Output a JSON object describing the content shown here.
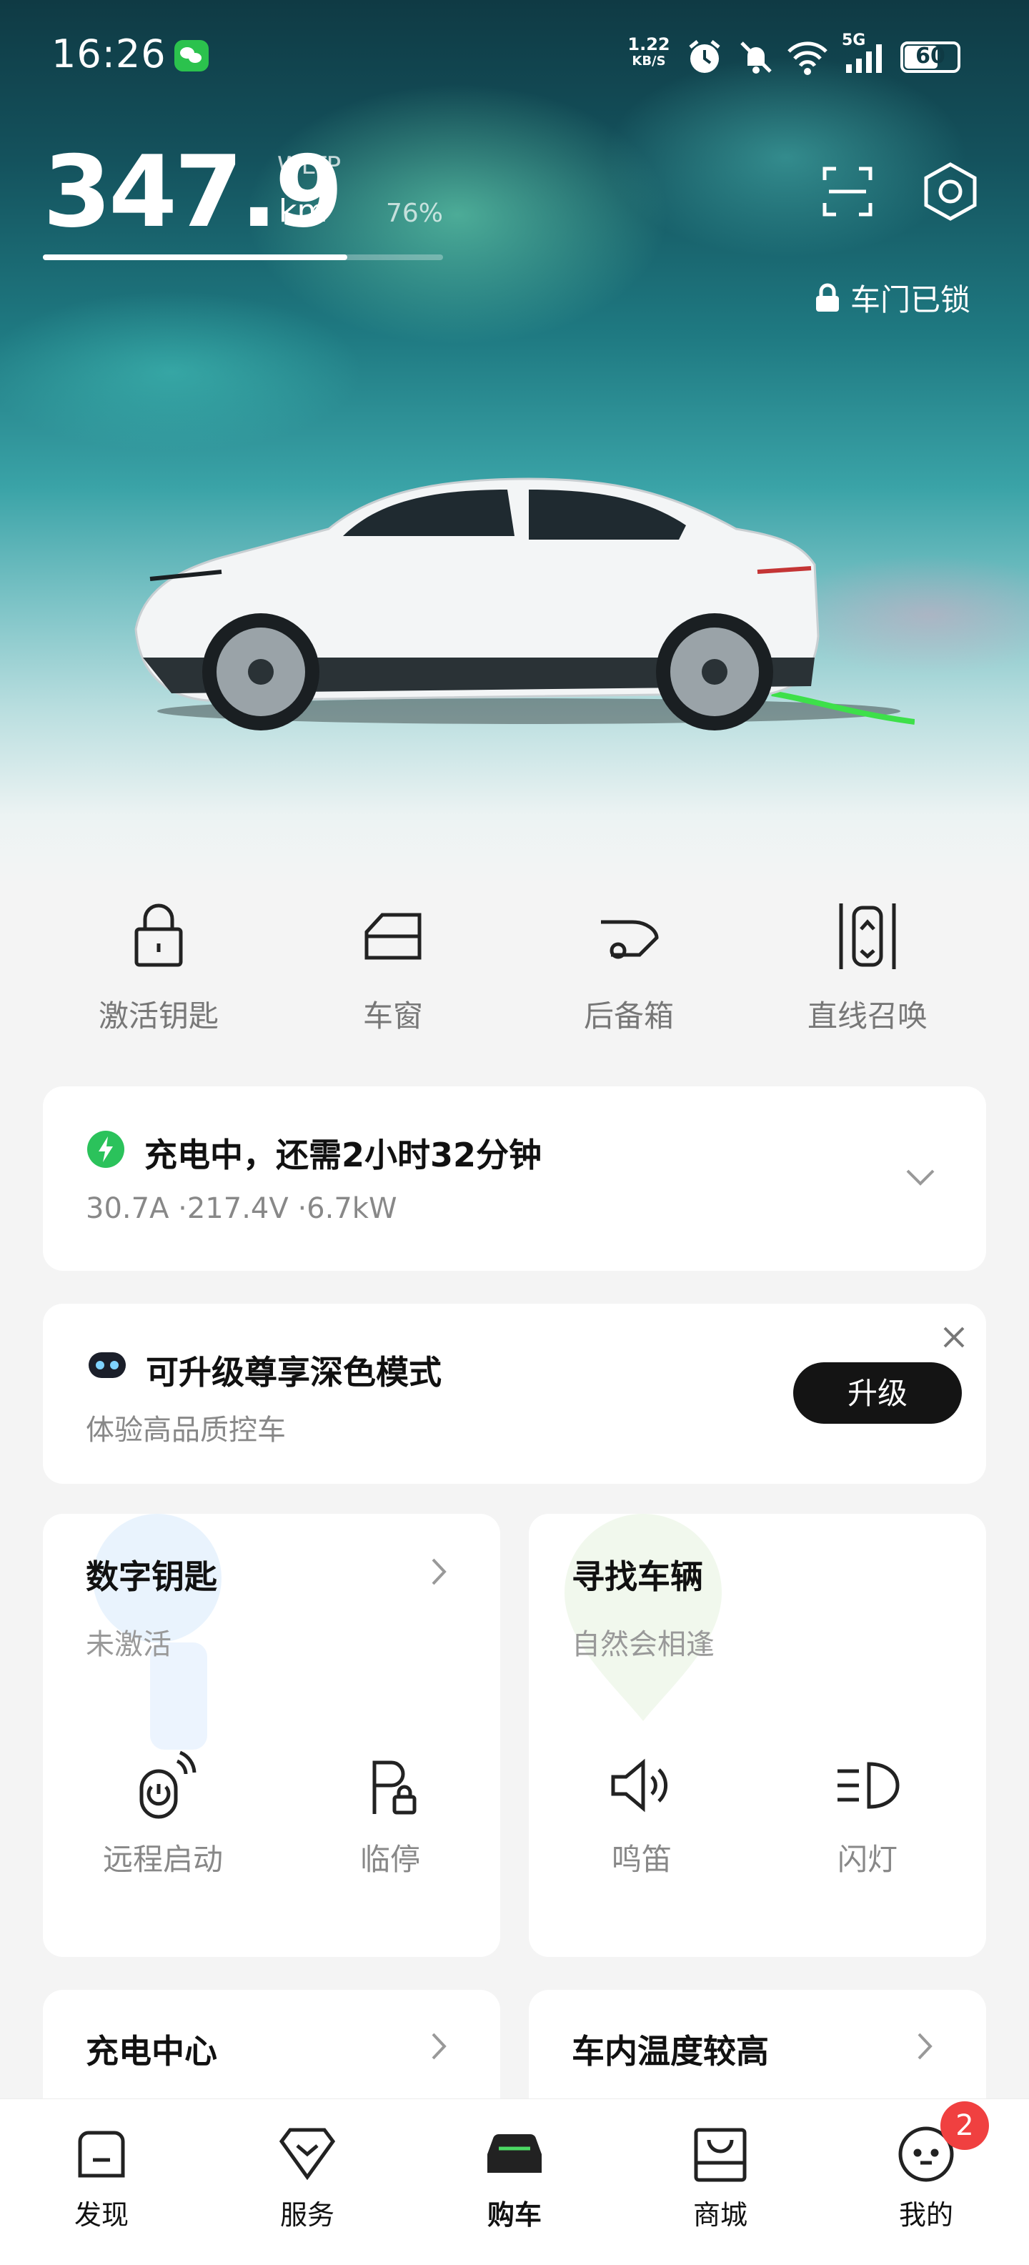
{
  "status_bar": {
    "time": "16:26",
    "net_speed": "1.22",
    "net_unit": "KB/S",
    "signal": "5G",
    "battery": "60"
  },
  "range": {
    "value": "347.9",
    "standard": "WLTP",
    "unit": "km",
    "battery_percent": "76%",
    "battery_fraction": 0.76
  },
  "lock_status": "车门已锁",
  "quick_actions": [
    {
      "label": "激活钥匙",
      "icon": "lock-icon"
    },
    {
      "label": "车窗",
      "icon": "window-icon"
    },
    {
      "label": "后备箱",
      "icon": "trunk-icon"
    },
    {
      "label": "直线召唤",
      "icon": "summon-icon"
    }
  ],
  "charging": {
    "title": "充电中，还需2小时32分钟",
    "details": "30.7A ·217.4V ·6.7kW"
  },
  "promo": {
    "title": "可升级尊享深色模式",
    "subtitle": "体验高品质控车",
    "button": "升级"
  },
  "digital_key": {
    "title": "数字钥匙",
    "subtitle": "未激活",
    "actions": [
      "远程启动",
      "临停"
    ]
  },
  "find_car": {
    "title": "寻找车辆",
    "subtitle": "自然会相逢",
    "actions": [
      "鸣笛",
      "闪灯"
    ]
  },
  "charge_center": {
    "title": "充电中心"
  },
  "cabin_temp": {
    "title": "车内温度较高"
  },
  "nav": {
    "items": [
      "发现",
      "服务",
      "购车",
      "商城",
      "我的"
    ],
    "active": "购车",
    "badge": "2"
  },
  "colors": {
    "accent_green": "#2bc25b",
    "charge_cable": "#3de04a",
    "badge_red": "#f04040"
  }
}
